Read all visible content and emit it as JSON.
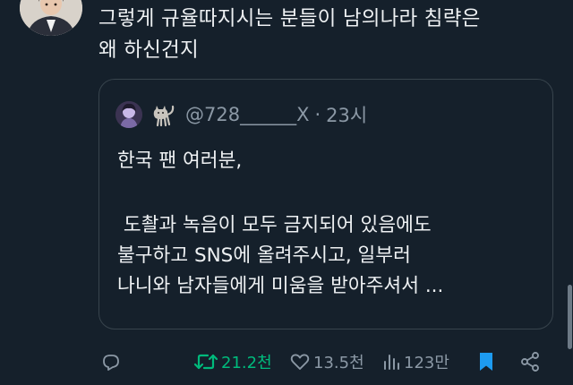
{
  "tweet": {
    "text_lines": [
      "그렇게 규율따지시는 분들이 남의나라 침략은",
      "왜 하신건지"
    ],
    "avatar_icon": "profile-photo-icon"
  },
  "quote": {
    "emoji_icon": "black-cat-icon",
    "handle": "@728______X",
    "separator": "·",
    "time": "23시",
    "lines": [
      "한국 팬 여러분,",
      "",
      " 도촬과 녹음이 모두 금지되어 있음에도",
      "불구하고 SNS에 올려주시고, 일부러",
      "나니와 남자들에게 미움을 받아주셔서 ..."
    ]
  },
  "actions": {
    "reply_icon": "reply-icon",
    "retweet_icon": "retweet-icon",
    "retweet_count": "21.2천",
    "like_icon": "heart-icon",
    "like_count": "13.5천",
    "views_icon": "views-chart-icon",
    "views_count": "123만",
    "bookmark_icon": "bookmark-icon",
    "share_icon": "share-icon"
  },
  "colors": {
    "background": "#15202b",
    "text": "#e7e9ea",
    "muted": "#8b98a5",
    "border": "#38444d",
    "retweet": "#00ba7c",
    "bookmark": "#1d9bf0"
  }
}
